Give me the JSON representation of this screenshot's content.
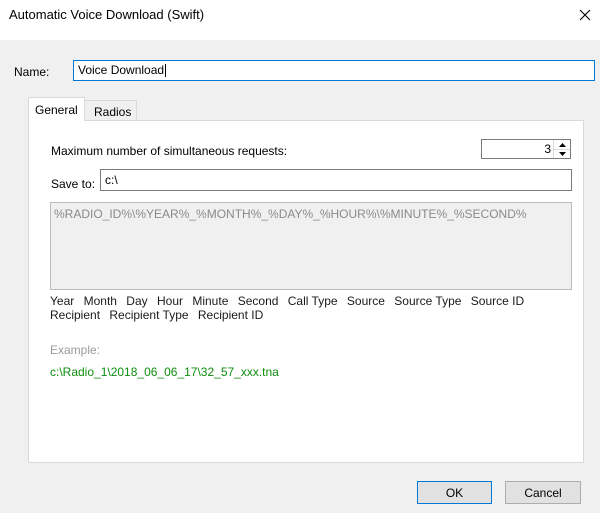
{
  "window": {
    "title": "Automatic Voice Download (Swift)"
  },
  "name_field": {
    "label": "Name:",
    "value": "Voice Download"
  },
  "tabs": [
    {
      "label": "General",
      "selected": true
    },
    {
      "label": "Radios",
      "selected": false
    }
  ],
  "general": {
    "max_requests": {
      "label": "Maximum number of simultaneous requests:",
      "value": "3"
    },
    "save_to": {
      "label": "Save to:",
      "value": "c:\\"
    },
    "pattern": "%RADIO_ID%\\%YEAR%_%MONTH%_%DAY%_%HOUR%\\%MINUTE%_%SECOND%",
    "tokens": [
      "Year",
      "Month",
      "Day",
      "Hour",
      "Minute",
      "Second",
      "Call Type",
      "Source",
      "Source Type",
      "Source ID",
      "Recipient",
      "Recipient Type",
      "Recipient ID"
    ],
    "example_label": "Example:",
    "example_value": "c:\\Radio_1\\2018_06_06_17\\32_57_xxx.tna"
  },
  "buttons": {
    "ok": "OK",
    "cancel": "Cancel"
  },
  "icons": {
    "close": "close-icon",
    "spin_up": "arrow-up-icon",
    "spin_down": "arrow-down-icon"
  },
  "colors": {
    "accent": "#0078d7",
    "example_text": "#0e8e0e"
  }
}
